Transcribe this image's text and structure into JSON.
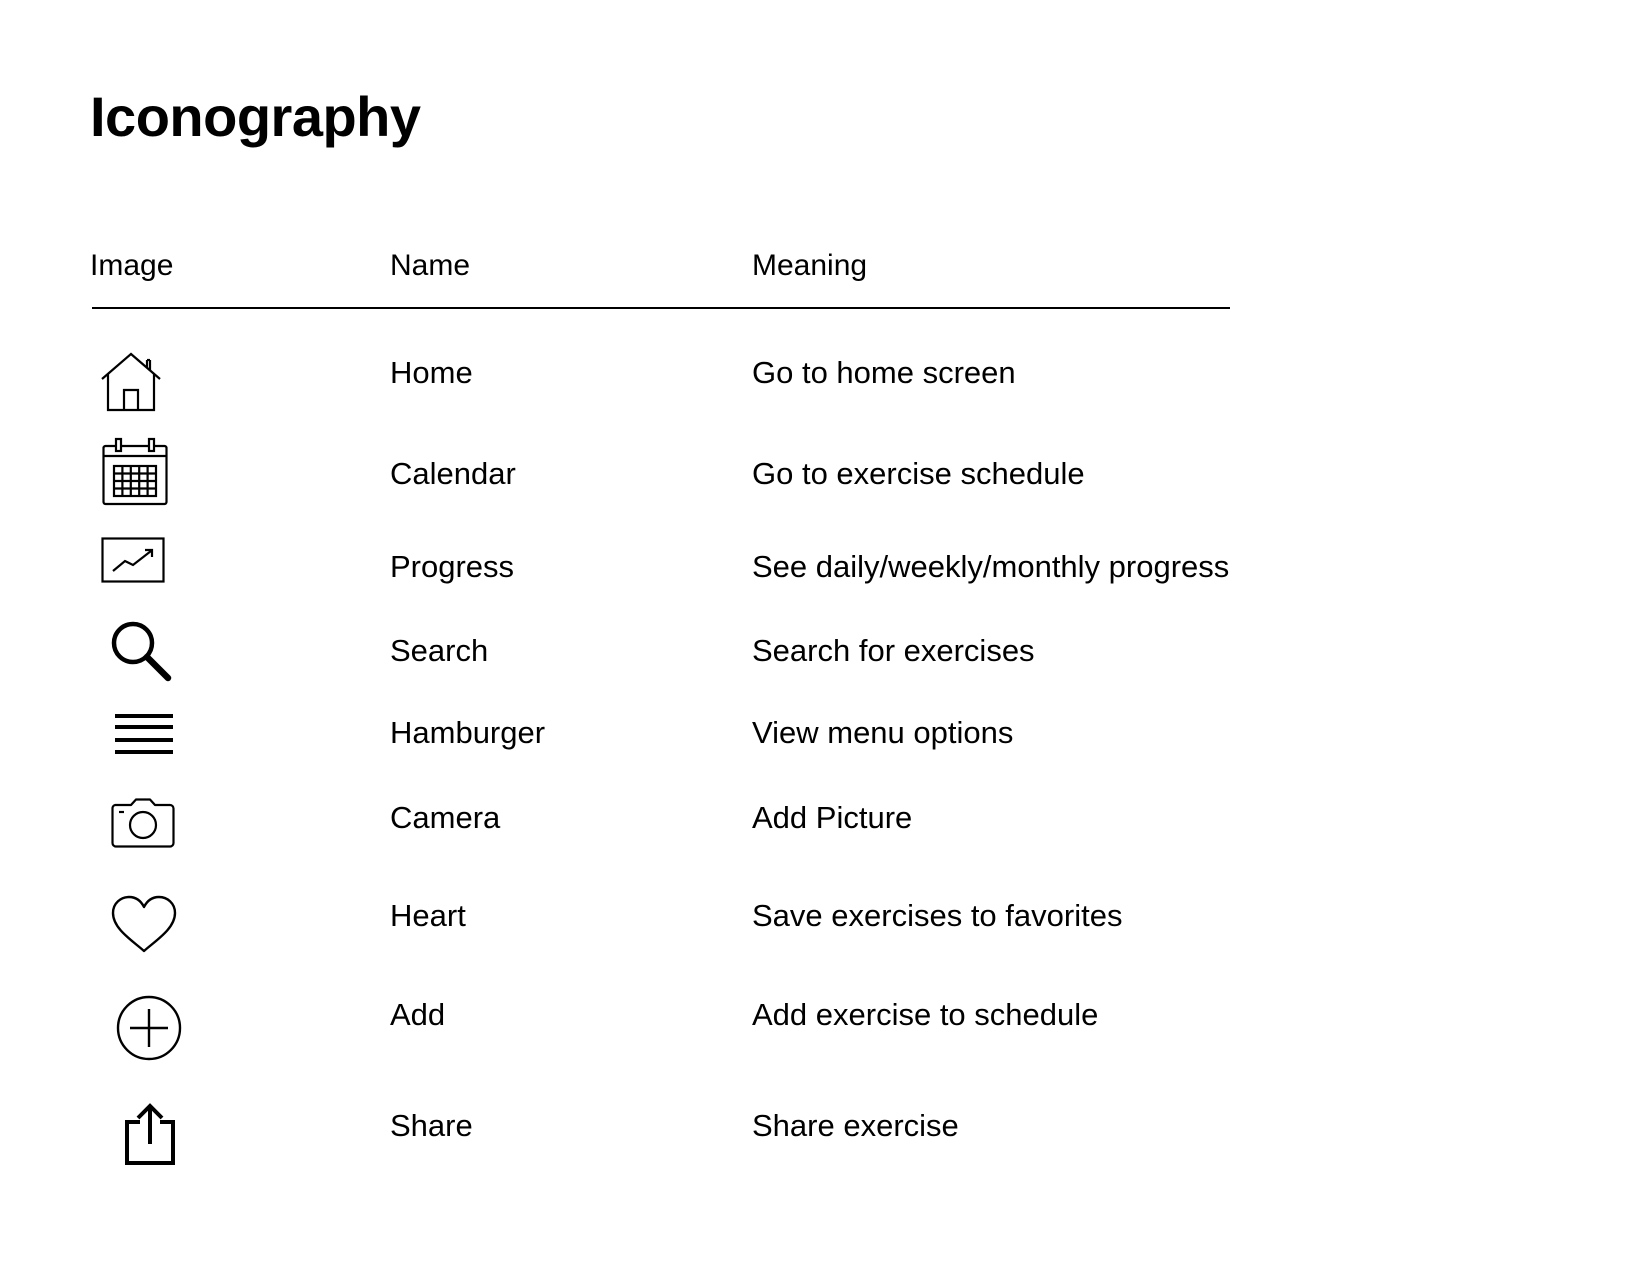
{
  "page": {
    "title": "Iconography"
  },
  "table": {
    "headers": [
      "Image",
      "Name",
      "Meaning"
    ],
    "rows": [
      {
        "icon": "home-icon",
        "name": "Home",
        "meaning": "Go to home screen"
      },
      {
        "icon": "calendar-icon",
        "name": "Calendar",
        "meaning": "Go to exercise schedule"
      },
      {
        "icon": "progress-chart-icon",
        "name": "Progress",
        "meaning": "See daily/weekly/monthly progress"
      },
      {
        "icon": "search-icon",
        "name": "Search",
        "meaning": "Search for exercises"
      },
      {
        "icon": "hamburger-menu-icon",
        "name": "Hamburger",
        "meaning": "View menu options"
      },
      {
        "icon": "camera-icon",
        "name": "Camera",
        "meaning": "Add Picture"
      },
      {
        "icon": "heart-icon",
        "name": "Heart",
        "meaning": "Save exercises to favorites"
      },
      {
        "icon": "add-circle-icon",
        "name": "Add",
        "meaning": "Add exercise to schedule"
      },
      {
        "icon": "share-icon",
        "name": "Share",
        "meaning": "Share exercise"
      }
    ]
  }
}
